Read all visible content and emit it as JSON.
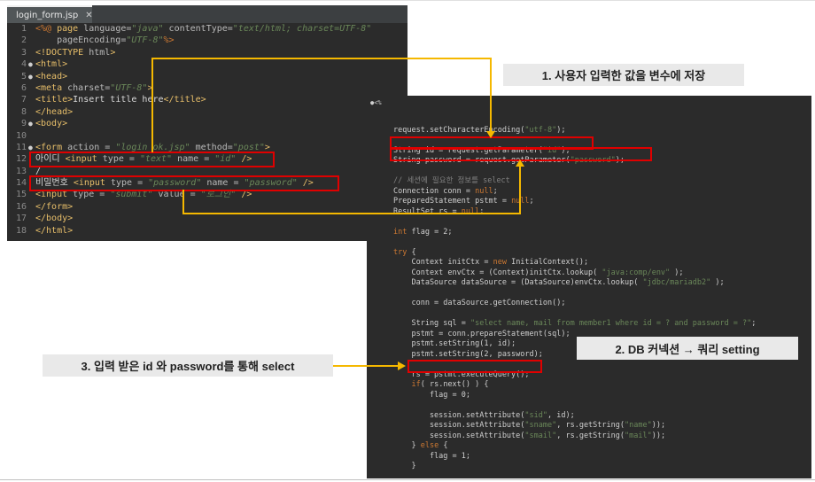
{
  "left_editor": {
    "tab": {
      "title": "login_form.jsp",
      "close": "✕"
    },
    "lines": [
      {
        "n": "1",
        "fold": "",
        "spans": [
          [
            "<%@ ",
            "c-dir"
          ],
          [
            "page ",
            "c-tag"
          ],
          [
            "language=",
            "c-attr"
          ],
          [
            "\"java\" ",
            "c-str"
          ],
          [
            "contentType=",
            "c-attr"
          ],
          [
            "\"text/html; charset=UTF-8\"",
            "c-str"
          ]
        ]
      },
      {
        "n": "2",
        "fold": "",
        "spans": [
          [
            "    pageEncoding=",
            "c-attr"
          ],
          [
            "\"UTF-8\"",
            "c-str"
          ],
          [
            "%>",
            "c-dir"
          ]
        ]
      },
      {
        "n": "3",
        "fold": "",
        "spans": [
          [
            "<!DOCTYPE ",
            "c-tag"
          ],
          [
            "html",
            "c-attr"
          ],
          [
            ">",
            "c-tag"
          ]
        ]
      },
      {
        "n": "4",
        "fold": "●",
        "spans": [
          [
            "<html>",
            "c-tag"
          ]
        ]
      },
      {
        "n": "5",
        "fold": "●",
        "spans": [
          [
            "<head>",
            "c-tag"
          ]
        ]
      },
      {
        "n": "6",
        "fold": "",
        "spans": [
          [
            "<meta ",
            "c-tag"
          ],
          [
            "charset=",
            "c-attr"
          ],
          [
            "\"UTF-8\"",
            "c-str"
          ],
          [
            ">",
            "c-tag"
          ]
        ]
      },
      {
        "n": "7",
        "fold": "",
        "spans": [
          [
            "<title>",
            "c-tag"
          ],
          [
            "Insert title here",
            "c-text"
          ],
          [
            "</title>",
            "c-tag"
          ]
        ]
      },
      {
        "n": "8",
        "fold": "",
        "spans": [
          [
            "</head>",
            "c-tag"
          ]
        ]
      },
      {
        "n": "9",
        "fold": "●",
        "spans": [
          [
            "<body>",
            "c-tag"
          ]
        ]
      },
      {
        "n": "10",
        "fold": "",
        "spans": []
      },
      {
        "n": "11",
        "fold": "●",
        "spans": [
          [
            "<form ",
            "c-tag"
          ],
          [
            "action = ",
            "c-attr"
          ],
          [
            "\"login_ok.jsp\" ",
            "c-str"
          ],
          [
            "method=",
            "c-attr"
          ],
          [
            "\"post\"",
            "c-str"
          ],
          [
            ">",
            "c-tag"
          ]
        ]
      },
      {
        "n": "12",
        "fold": "",
        "spans": [
          [
            "아이디 ",
            "c-text"
          ],
          [
            "<input ",
            "c-tag"
          ],
          [
            "type = ",
            "c-attr"
          ],
          [
            "\"text\" ",
            "c-str"
          ],
          [
            "name = ",
            "c-attr"
          ],
          [
            "\"id\" ",
            "c-str"
          ],
          [
            "/>",
            "c-tag"
          ]
        ]
      },
      {
        "n": "13",
        "fold": "",
        "spans": [
          [
            "/",
            "c-text"
          ]
        ]
      },
      {
        "n": "14",
        "fold": "",
        "spans": [
          [
            "비밀번호 ",
            "c-text"
          ],
          [
            "<input ",
            "c-tag"
          ],
          [
            "type = ",
            "c-attr"
          ],
          [
            "\"password\" ",
            "c-str"
          ],
          [
            "name = ",
            "c-attr"
          ],
          [
            "\"password\" ",
            "c-str"
          ],
          [
            "/>",
            "c-tag"
          ]
        ]
      },
      {
        "n": "15",
        "fold": "",
        "spans": [
          [
            "<input ",
            "c-tag"
          ],
          [
            "type = ",
            "c-attr"
          ],
          [
            "\"submit\" ",
            "c-str"
          ],
          [
            "value = ",
            "c-attr"
          ],
          [
            "\"로그인\" ",
            "c-str"
          ],
          [
            "/>",
            "c-tag"
          ]
        ]
      },
      {
        "n": "16",
        "fold": "",
        "spans": [
          [
            "</form>",
            "c-tag"
          ]
        ]
      },
      {
        "n": "17",
        "fold": "",
        "spans": [
          [
            "</body>",
            "c-tag"
          ]
        ]
      },
      {
        "n": "18",
        "fold": "",
        "spans": [
          [
            "</html>",
            "c-tag"
          ]
        ]
      }
    ]
  },
  "right_editor": {
    "gutter_mark": "●<%",
    "lines": [
      {
        "spans": []
      },
      {
        "spans": [
          [
            "request.setCharacterEncoding(",
            ""
          ],
          [
            "\"utf-8\"",
            "r-str"
          ],
          [
            ");",
            ""
          ]
        ]
      },
      {
        "spans": []
      },
      {
        "spans": [
          [
            "String id = request.getParameter(",
            ""
          ],
          [
            "\"id\"",
            "r-str"
          ],
          [
            ");",
            ""
          ]
        ]
      },
      {
        "spans": [
          [
            "String password = request.getParameter(",
            ""
          ],
          [
            "\"password\"",
            "r-str"
          ],
          [
            ");",
            ""
          ]
        ]
      },
      {
        "spans": []
      },
      {
        "spans": [
          [
            "// 세션에 필요한 정보를 select",
            "r-cm"
          ]
        ]
      },
      {
        "spans": [
          [
            "Connection conn = ",
            ""
          ],
          [
            "null",
            "r-kw"
          ],
          [
            ";",
            ""
          ]
        ]
      },
      {
        "spans": [
          [
            "PreparedStatement pstmt = ",
            ""
          ],
          [
            "null",
            "r-kw"
          ],
          [
            ";",
            ""
          ]
        ]
      },
      {
        "spans": [
          [
            "ResultSet rs = ",
            ""
          ],
          [
            "null",
            "r-kw"
          ],
          [
            ";",
            ""
          ]
        ]
      },
      {
        "spans": []
      },
      {
        "spans": [
          [
            "int",
            "r-kw"
          ],
          [
            " flag = 2;",
            ""
          ]
        ]
      },
      {
        "spans": []
      },
      {
        "spans": [
          [
            "try",
            "r-kw"
          ],
          [
            " {",
            ""
          ]
        ]
      },
      {
        "spans": [
          [
            "    Context initCtx = ",
            ""
          ],
          [
            "new",
            "r-kw"
          ],
          [
            " InitialContext();",
            ""
          ]
        ]
      },
      {
        "spans": [
          [
            "    Context envCtx = (Context)initCtx.lookup( ",
            ""
          ],
          [
            "\"java:comp/env\"",
            "r-str"
          ],
          [
            " );",
            ""
          ]
        ]
      },
      {
        "spans": [
          [
            "    DataSource dataSource = (DataSource)envCtx.lookup( ",
            ""
          ],
          [
            "\"jdbc/mariadb2\"",
            "r-str"
          ],
          [
            " );",
            ""
          ]
        ]
      },
      {
        "spans": []
      },
      {
        "spans": [
          [
            "    conn = dataSource.getConnection();",
            ""
          ]
        ]
      },
      {
        "spans": []
      },
      {
        "spans": [
          [
            "    String sql = ",
            ""
          ],
          [
            "\"select name, mail from member1 where id = ? and password = ?\"",
            "r-str"
          ],
          [
            ";",
            ""
          ]
        ]
      },
      {
        "spans": [
          [
            "    pstmt = conn.prepareStatement(sql);",
            ""
          ]
        ]
      },
      {
        "spans": [
          [
            "    pstmt.setString(1, id);",
            ""
          ]
        ]
      },
      {
        "spans": [
          [
            "    pstmt.setString(2, password);",
            ""
          ]
        ]
      },
      {
        "spans": []
      },
      {
        "spans": [
          [
            "    rs = pstmt.executeQuery();",
            ""
          ]
        ]
      },
      {
        "spans": [
          [
            "    ",
            ""
          ],
          [
            "if",
            "r-kw"
          ],
          [
            "( rs.next() ) {",
            ""
          ]
        ]
      },
      {
        "spans": [
          [
            "        flag = 0;",
            ""
          ]
        ]
      },
      {
        "spans": []
      },
      {
        "spans": [
          [
            "        session.setAttribute(",
            ""
          ],
          [
            "\"sid\"",
            "r-str"
          ],
          [
            ", id);",
            ""
          ]
        ]
      },
      {
        "spans": [
          [
            "        session.setAttribute(",
            ""
          ],
          [
            "\"sname\"",
            "r-str"
          ],
          [
            ", rs.getString(",
            ""
          ],
          [
            "\"name\"",
            "r-str"
          ],
          [
            "));",
            ""
          ]
        ]
      },
      {
        "spans": [
          [
            "        session.setAttribute(",
            ""
          ],
          [
            "\"smail\"",
            "r-str"
          ],
          [
            ", rs.getString(",
            ""
          ],
          [
            "\"mail\"",
            "r-str"
          ],
          [
            "));",
            ""
          ]
        ]
      },
      {
        "spans": [
          [
            "    } ",
            ""
          ],
          [
            "else",
            "r-kw"
          ],
          [
            " {",
            ""
          ]
        ]
      },
      {
        "spans": [
          [
            "        flag = 1;",
            ""
          ]
        ]
      },
      {
        "spans": [
          [
            "    }",
            ""
          ]
        ]
      }
    ]
  },
  "callouts": {
    "step1": "1. 사용자 입력한 값을 변수에 저장",
    "step2": "2. DB 커넥션 → 쿼리 setting",
    "step3": "3. 입력 받은 id 와 password를 통해 select"
  },
  "colors": {
    "connector": "#f5b800",
    "highlight": "#e00000",
    "editor_bg": "#2b2b2b"
  }
}
